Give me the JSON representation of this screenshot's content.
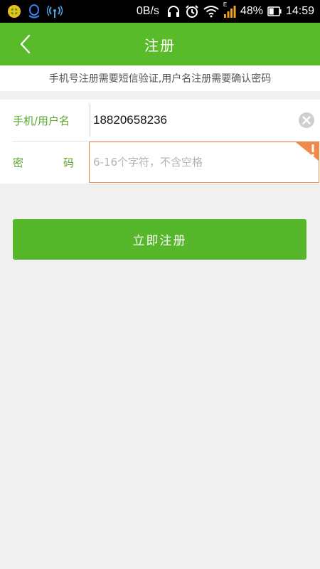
{
  "status_bar": {
    "net_speed": "0B/s",
    "battery_percent": "48%",
    "time": "14:59",
    "network_type": "E",
    "icons": [
      "app-badge-icon",
      "qq-icon",
      "broadcast-icon",
      "headphones-icon",
      "alarm-icon",
      "wifi-icon",
      "signal-icon",
      "battery-icon"
    ],
    "battery_level": 0.48
  },
  "header": {
    "title": "注册",
    "back_icon": "chevron-left-icon"
  },
  "hint": {
    "text": "手机号注册需要短信验证,用户名注册需要确认密码"
  },
  "form": {
    "phone": {
      "label": "手机/用户名",
      "value": "18820658236",
      "clear_icon": "clear-icon"
    },
    "password": {
      "label_chars": [
        "密",
        "码"
      ],
      "placeholder": "6-16个字符，不含空格",
      "value": "",
      "warning_icon": "warning-icon"
    }
  },
  "actions": {
    "register_label": "立即注册"
  },
  "colors": {
    "brand_green": "#59ba2a",
    "button_green": "#56b72a",
    "label_green": "#5aa52e",
    "error_orange": "#f08a4b"
  }
}
